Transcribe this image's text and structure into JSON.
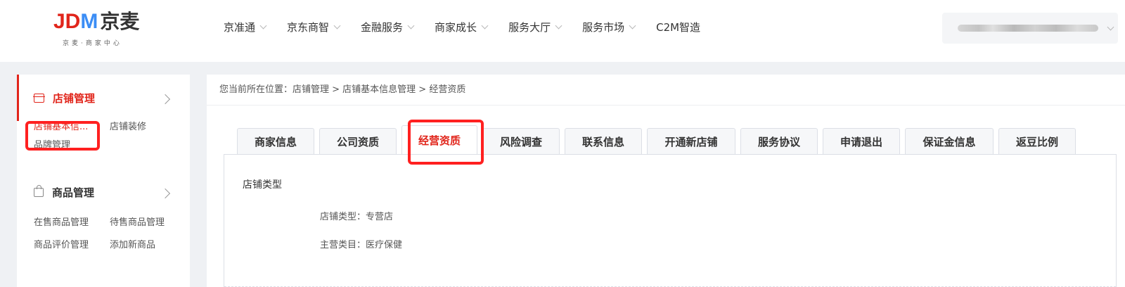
{
  "header": {
    "logo": {
      "jd": "JD",
      "m": "M",
      "cn": "京麦",
      "subtitle": "京麦·商家中心"
    },
    "nav": [
      {
        "label": "京准通",
        "has_dropdown": true
      },
      {
        "label": "京东商智",
        "has_dropdown": true
      },
      {
        "label": "金融服务",
        "has_dropdown": true
      },
      {
        "label": "商家成长",
        "has_dropdown": true
      },
      {
        "label": "服务大厅",
        "has_dropdown": true
      },
      {
        "label": "服务市场",
        "has_dropdown": true
      },
      {
        "label": "C2M智造",
        "has_dropdown": false
      }
    ]
  },
  "sidebar": {
    "groups": [
      {
        "title": "店铺管理",
        "icon": "shop-icon",
        "active": true,
        "links": [
          "店铺基本信...",
          "店铺装修",
          "品牌管理"
        ]
      },
      {
        "title": "商品管理",
        "icon": "bag-icon",
        "active": false,
        "links": [
          "在售商品管理",
          "待售商品管理",
          "商品评价管理",
          "添加新商品"
        ]
      }
    ]
  },
  "main": {
    "breadcrumb": "您当前所在位置：店铺管理 > 店铺基本信息管理 > 经营资质",
    "tabs": [
      {
        "label": "商家信息"
      },
      {
        "label": "公司资质"
      },
      {
        "label": "经营资质",
        "active": true
      },
      {
        "label": "风险调查"
      },
      {
        "label": "联系信息"
      },
      {
        "label": "开通新店铺"
      },
      {
        "label": "服务协议"
      },
      {
        "label": "申请退出"
      },
      {
        "label": "保证金信息"
      },
      {
        "label": "返豆比例"
      }
    ],
    "section_title": "店铺类型",
    "fields": [
      {
        "text": "店铺类型：专营店"
      },
      {
        "text": "主营类目：医疗保健"
      }
    ]
  },
  "colors": {
    "accent": "#e1251b",
    "highlight": "#ff2020",
    "brand_blue": "#3b8df5"
  }
}
